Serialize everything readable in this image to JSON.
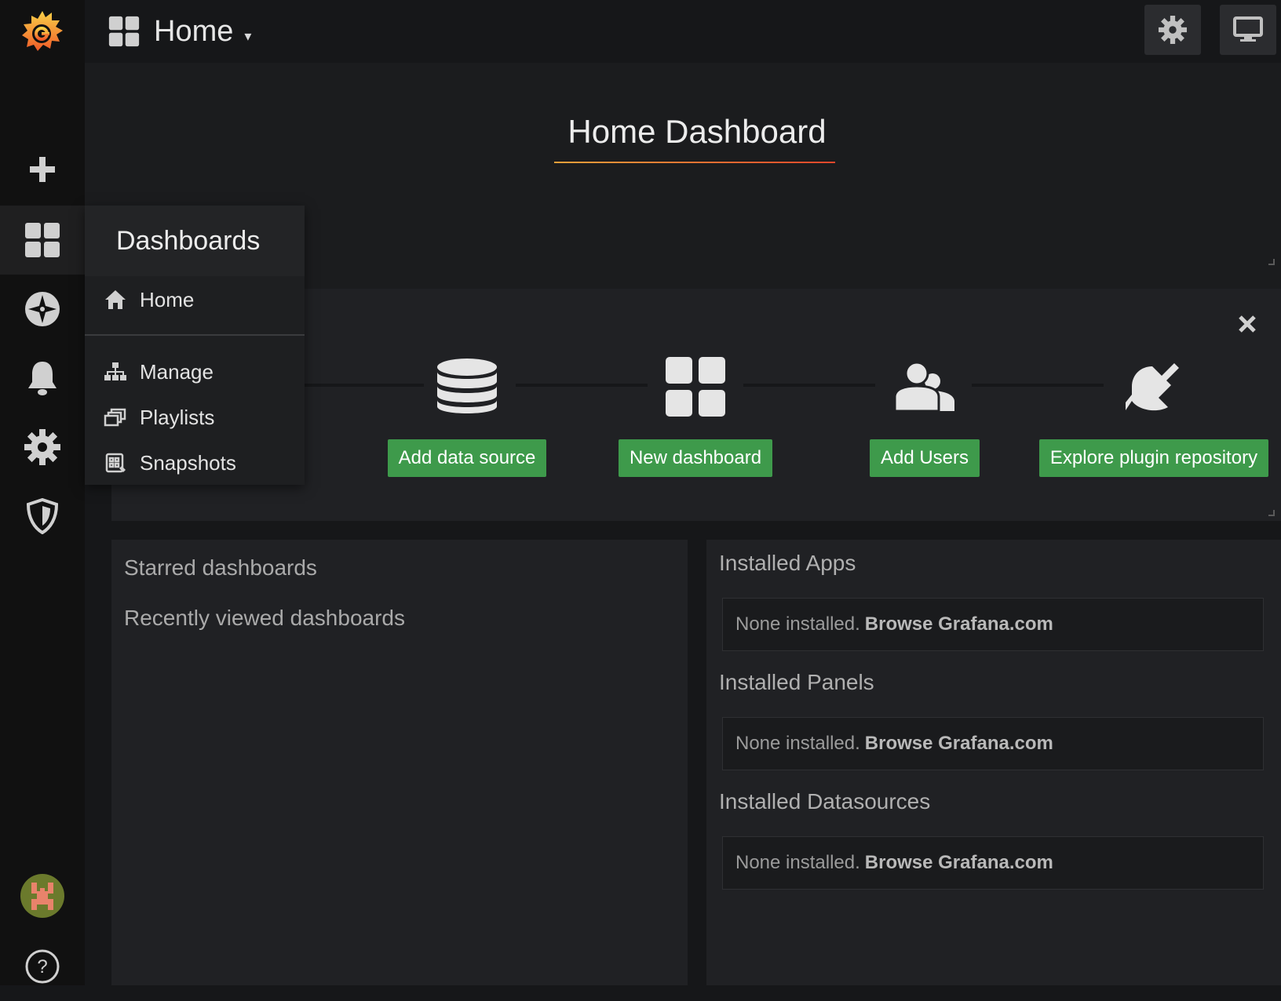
{
  "topbar": {
    "title": "Home",
    "caret": "▾"
  },
  "welcome": {
    "title": "Home Dashboard"
  },
  "getting_started": {
    "steps": [
      {
        "label": "Add data source",
        "icon": "database-icon"
      },
      {
        "label": "New dashboard",
        "icon": "dashboard-grid-icon"
      },
      {
        "label": "Add Users",
        "icon": "users-icon"
      },
      {
        "label": "Explore plugin repository",
        "icon": "plug-icon"
      }
    ]
  },
  "left_panel": {
    "starred": "Starred dashboards",
    "recent": "Recently viewed dashboards"
  },
  "right_panel": {
    "sections": [
      {
        "title": "Installed Apps",
        "none": "None installed.",
        "link": "Browse Grafana.com"
      },
      {
        "title": "Installed Panels",
        "none": "None installed.",
        "link": "Browse Grafana.com"
      },
      {
        "title": "Installed Datasources",
        "none": "None installed.",
        "link": "Browse Grafana.com"
      }
    ]
  },
  "menu": {
    "header": "Dashboards",
    "items": [
      {
        "label": "Home",
        "icon": "home-icon"
      },
      {
        "label": "Manage",
        "icon": "sitemap-icon"
      },
      {
        "label": "Playlists",
        "icon": "playlist-icon"
      },
      {
        "label": "Snapshots",
        "icon": "snapshot-icon"
      }
    ]
  },
  "colors": {
    "accent_green": "#3e9a4b",
    "grafana_orange": "#f2a13a"
  }
}
